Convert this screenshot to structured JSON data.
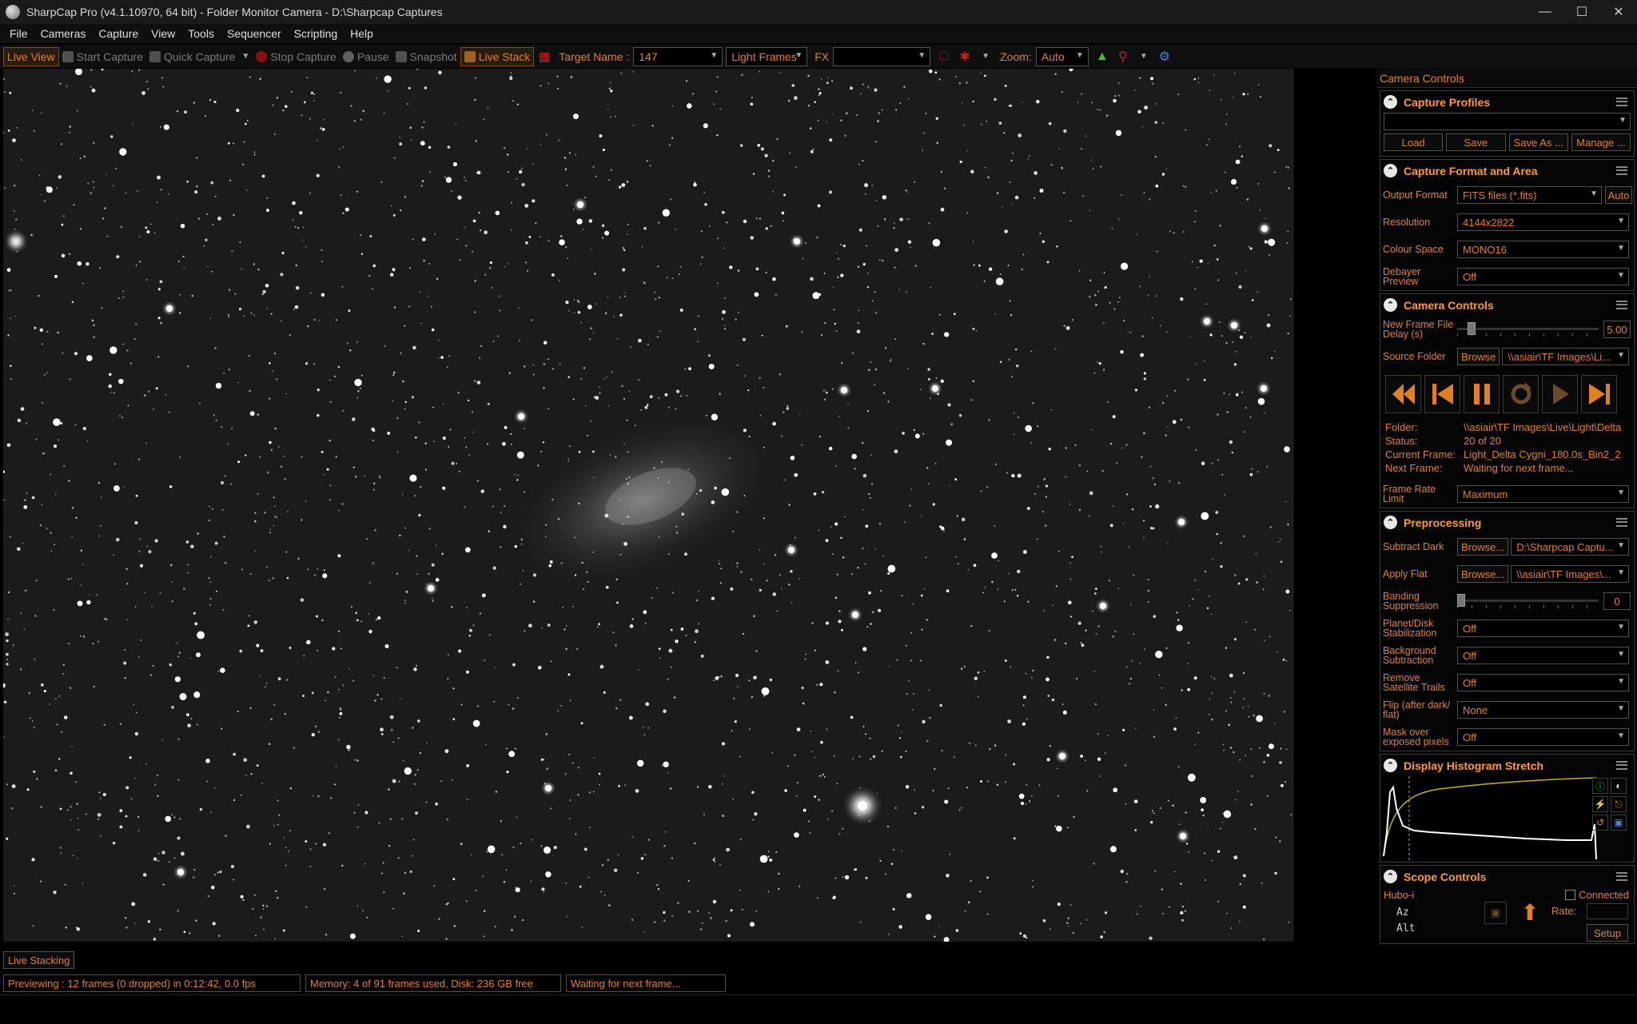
{
  "window": {
    "title": "SharpCap Pro (v4.1.10970, 64 bit) - Folder Monitor Camera - D:\\Sharpcap Captures"
  },
  "menu": [
    "File",
    "Cameras",
    "Capture",
    "View",
    "Tools",
    "Sequencer",
    "Scripting",
    "Help"
  ],
  "toolbar": {
    "live_view": "Live View",
    "start_capture": "Start Capture",
    "quick_capture": "Quick Capture",
    "stop_capture": "Stop Capture",
    "pause": "Pause",
    "snapshot": "Snapshot",
    "live_stack": "Live Stack",
    "target_name_label": "Target Name :",
    "target_name_value": "147",
    "frame_type": "Light Frames",
    "fx_label": "FX",
    "fx_value": "",
    "zoom_label": "Zoom:",
    "zoom_value": "Auto"
  },
  "panel": {
    "header": "Camera Controls",
    "capture_profiles": {
      "title": "Capture Profiles",
      "selected": "",
      "load": "Load",
      "save": "Save",
      "save_as": "Save As ...",
      "manage": "Manage ..."
    },
    "capture_format": {
      "title": "Capture Format and Area",
      "output_format_label": "Output Format",
      "output_format_value": "FITS files (*.fits)",
      "auto": "Auto",
      "resolution_label": "Resolution",
      "resolution_value": "4144x2822",
      "colour_space_label": "Colour Space",
      "colour_space_value": "MONO16",
      "debayer_label": "Debayer Preview",
      "debayer_value": "Off"
    },
    "camera_controls": {
      "title": "Camera Controls",
      "delay_label": "New Frame File Delay (s)",
      "delay_value": "5.00",
      "delay_level": 0.1,
      "source_label": "Source Folder",
      "browse": "Browse",
      "source_value": "\\\\asiair\\TF Images\\Li...",
      "folder_label": "Folder:",
      "folder_value": "\\\\asiair\\TF Images\\Live\\Light\\Delta",
      "status_label": "Status:",
      "status_value": "20 of 20",
      "current_label": "Current Frame:",
      "current_value": "Light_Delta Cygni_180.0s_Bin2_2",
      "next_label": "Next Frame:",
      "next_value": "Waiting for next frame...",
      "frame_rate_label": "Frame Rate Limit",
      "frame_rate_value": "Maximum"
    },
    "preprocessing": {
      "title": "Preprocessing",
      "subtract_dark_label": "Subtract Dark",
      "subtract_dark_browse": "Browse...",
      "subtract_dark_value": "D:\\Sharpcap Captu...",
      "apply_flat_label": "Apply Flat",
      "apply_flat_browse": "Browse...",
      "apply_flat_value": "\\\\asiair\\TF Images\\...",
      "banding_label": "Banding Suppression",
      "banding_value": "0",
      "banding_level": 0,
      "planet_label": "Planet/Disk Stabilization",
      "planet_value": "Off",
      "background_label": "Background Subtraction",
      "background_value": "Off",
      "satellite_label": "Remove Satellite Trails",
      "satellite_value": "Off",
      "flip_label": "Flip (after dark/ flat)",
      "flip_value": "None",
      "mask_label": "Mask over exposed pixels",
      "mask_value": "Off"
    },
    "histogram": {
      "title": "Display Histogram Stretch"
    },
    "scope": {
      "title": "Scope Controls",
      "mount": "Hubo-i",
      "connected": "Connected",
      "az": "Az",
      "alt": "Alt",
      "rate_label": "Rate:",
      "setup": "Setup"
    }
  },
  "live_stacking_tab": "Live Stacking",
  "status": {
    "previewing": "Previewing : 12 frames (0 dropped) in 0:12:42, 0.0 fps",
    "memory": "Memory: 4 of 91 frames used, Disk: 236 GB free",
    "waiting": "Waiting for next frame..."
  },
  "colors": {
    "accent": "#e08020",
    "heading": "#ff9a2e",
    "background": "#000000"
  }
}
